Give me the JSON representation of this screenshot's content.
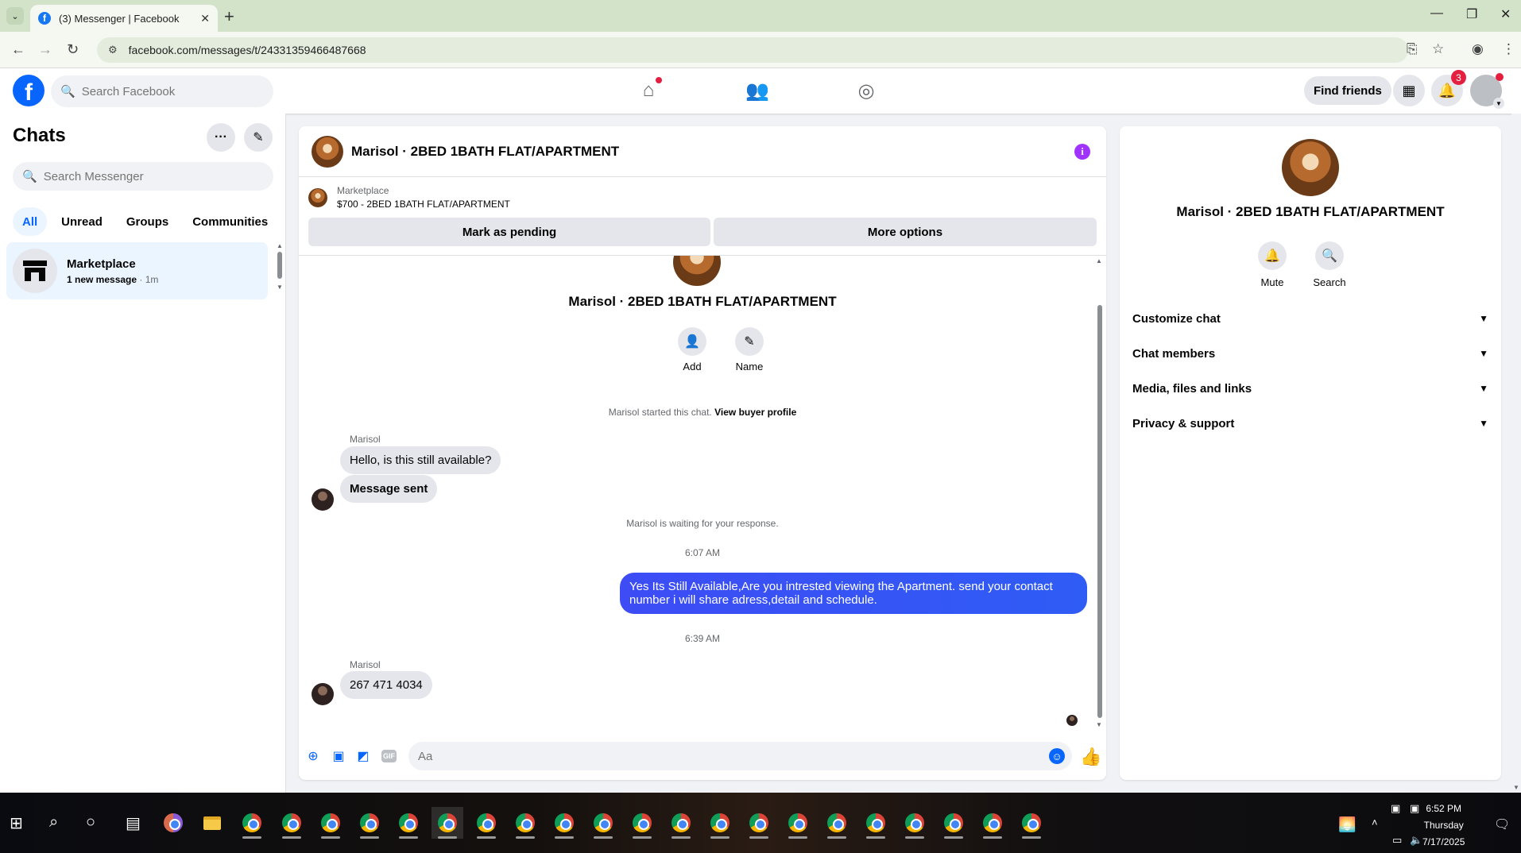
{
  "browser": {
    "tab_title": "(3) Messenger | Facebook",
    "tab_favicon": "f",
    "url": "facebook.com/messages/t/24331359466487668"
  },
  "fb": {
    "search_placeholder": "Search Facebook",
    "find_friends": "Find friends",
    "notifications_count": "3"
  },
  "chats": {
    "title": "Chats",
    "search_placeholder": "Search Messenger",
    "filters": [
      "All",
      "Unread",
      "Groups",
      "Communities"
    ],
    "items": [
      {
        "name": "Marketplace",
        "unread": "1 new message",
        "time": " · 1m"
      }
    ]
  },
  "conversation": {
    "title": "Marisol · 2BED 1BATH FLAT/APARTMENT",
    "marketplace_label": "Marketplace",
    "listing": "$700 - 2BED 1BATH FLAT/APARTMENT",
    "mark_pending": "Mark as pending",
    "more_options": "More options",
    "profile_name": "Marisol · 2BED 1BATH FLAT/APARTMENT",
    "add_label": "Add",
    "name_label": "Name",
    "started_text": "Marisol started this chat.",
    "view_buyer": "View buyer profile",
    "sender1": "Marisol",
    "msg1": "Hello, is this still available?",
    "msg2": "Message sent",
    "waiting": "Marisol is waiting for your response.",
    "time1": "6:07 AM",
    "outgoing": "Yes Its Still Available,Are you intrested viewing the Apartment. send your contact number i will share adress,detail and schedule.",
    "time2": "6:39 AM",
    "sender2": "Marisol",
    "msg3": "267 471 4034",
    "composer_placeholder": "Aa"
  },
  "info_panel": {
    "name": "Marisol · 2BED 1BATH FLAT/APARTMENT",
    "mute": "Mute",
    "search": "Search",
    "sections": [
      "Customize chat",
      "Chat members",
      "Media, files and links",
      "Privacy & support"
    ]
  },
  "taskbar": {
    "time": "6:52 PM",
    "day": "Thursday",
    "date": "7/17/2025"
  },
  "colors": {
    "fb_blue": "#0866ff",
    "outgoing_bubble": "#3d4cf5",
    "info_button": "#a033ff",
    "badge_red": "#e41e3f"
  },
  "icons": [
    "home-icon",
    "friends-icon",
    "groups-icon",
    "grid-menu-icon",
    "bell-icon",
    "compose-icon",
    "more-icon",
    "marketplace-store-icon",
    "info-icon",
    "add-person-icon",
    "pencil-icon",
    "plus-icon",
    "photo-icon",
    "sticker-icon",
    "gif-icon",
    "emoji-icon",
    "thumbs-up-icon",
    "mute-bell-icon",
    "search-icon",
    "chevron-down-icon"
  ]
}
